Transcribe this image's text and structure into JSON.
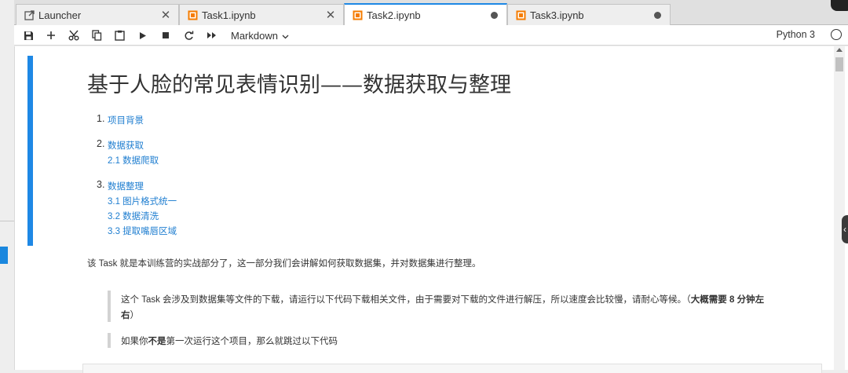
{
  "tabs": [
    {
      "label": "Launcher",
      "icon": "launcher-icon",
      "trailing": "close"
    },
    {
      "label": "Task1.ipynb",
      "icon": "notebook-icon",
      "trailing": "close"
    },
    {
      "label": "Task2.ipynb",
      "icon": "notebook-icon",
      "trailing": "unsaved-dot",
      "active": true
    },
    {
      "label": "Task3.ipynb",
      "icon": "notebook-icon",
      "trailing": "unsaved-dot"
    }
  ],
  "toolbar": {
    "buttons": [
      "save-icon",
      "add-cell-icon",
      "cut-icon",
      "copy-icon",
      "paste-icon",
      "run-icon",
      "stop-icon",
      "restart-icon",
      "fast-forward-icon"
    ],
    "cell_type": "Markdown",
    "kernel_name": "Python 3"
  },
  "notebook": {
    "title": "基于人脸的常见表情识别——数据获取与整理",
    "toc": [
      {
        "num": "1.",
        "label": "项目背景",
        "subs": []
      },
      {
        "num": "2.",
        "label": "数据获取",
        "subs": [
          "2.1 数据爬取"
        ]
      },
      {
        "num": "3.",
        "label": "数据整理",
        "subs": [
          "3.1 图片格式统一",
          "3.2 数据清洗",
          "3.3 提取嘴唇区域"
        ]
      }
    ],
    "intro": "该 Task 就是本训练营的实战部分了，这一部分我们会讲解如何获取数据集，并对数据集进行整理。",
    "quote1_text": "这个 Task 会涉及到数据集等文件的下载，请运行以下代码下载相关文件，由于需要对下载的文件进行解压，所以速度会比较慢，请耐心等候。（",
    "quote1_bold": "大概需要 8 分钟左右",
    "quote1_end": "）",
    "quote2_pre": "如果你",
    "quote2_bold": "不是",
    "quote2_post": "第一次运行这个项目，那么就跳过以下代码"
  },
  "colors": {
    "accent": "#1e88e5",
    "link": "#1f7ed0",
    "text": "#333333"
  }
}
